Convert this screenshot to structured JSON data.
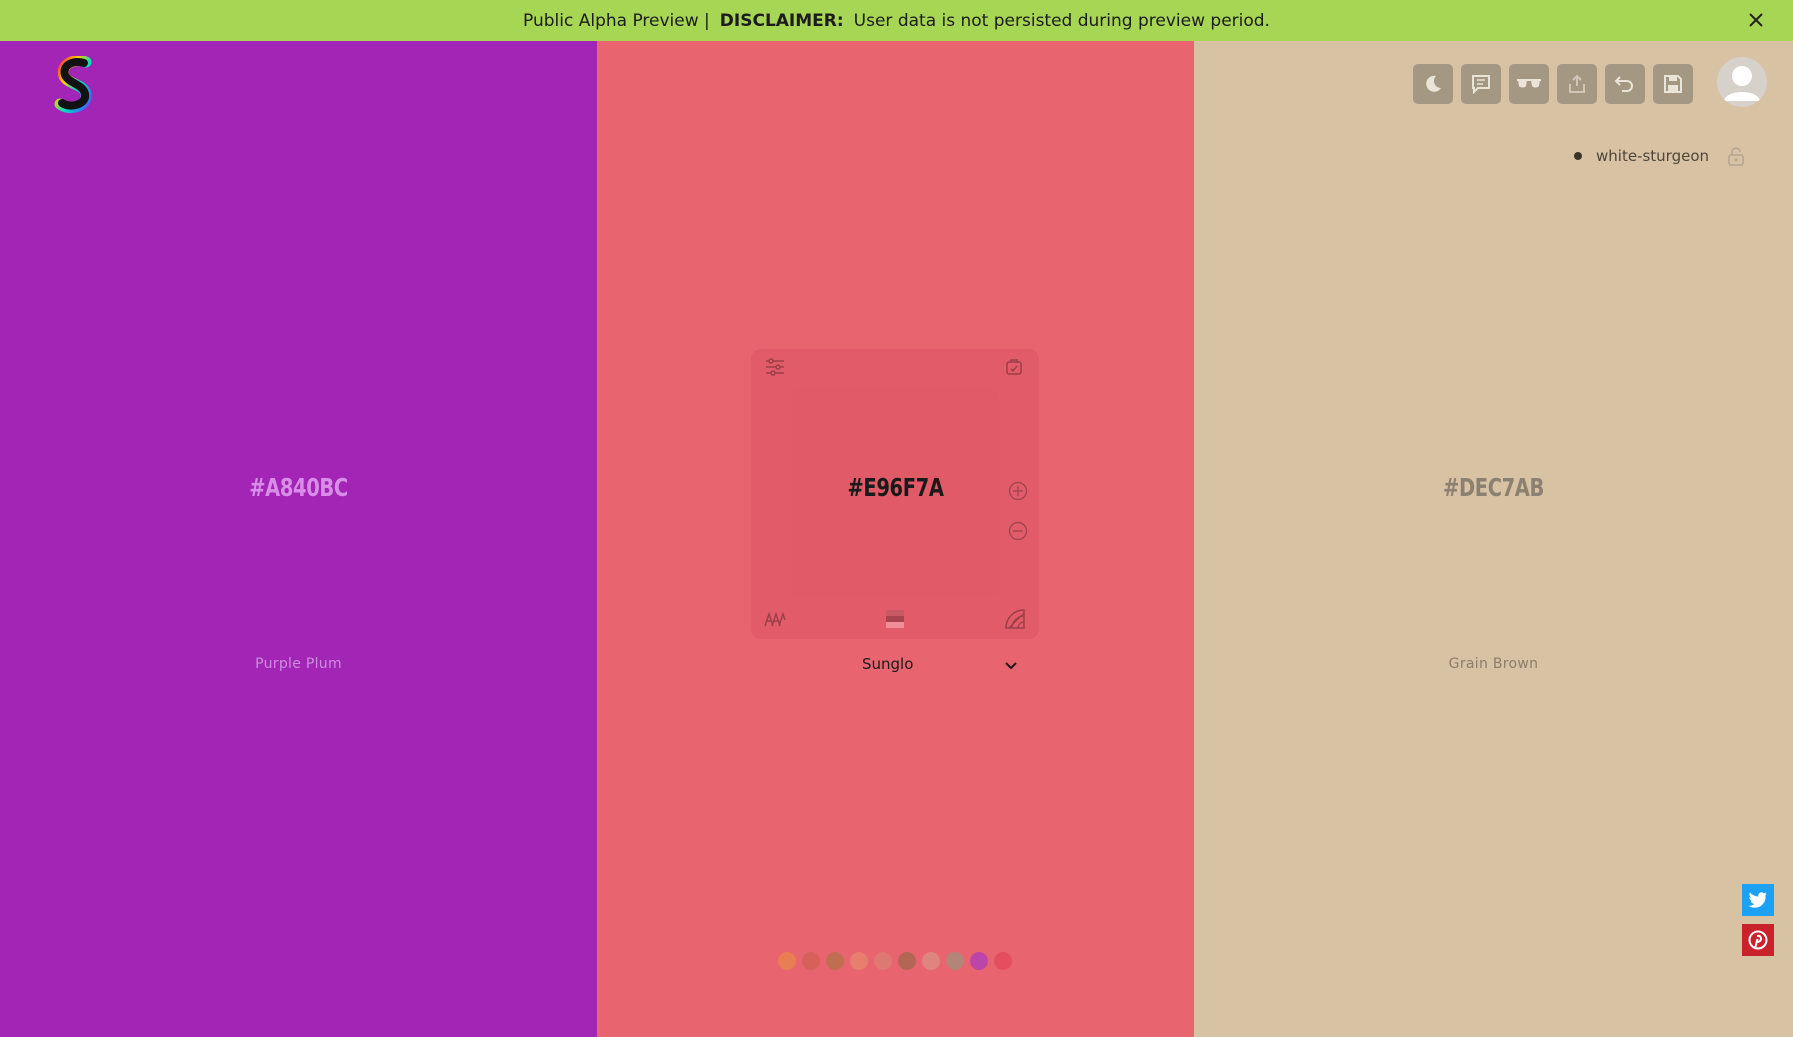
{
  "banner": {
    "prefix": "Public Alpha Preview |",
    "label": "DISCLAIMER:",
    "message": "User data is not persisted during preview period.",
    "close_icon": "close-icon"
  },
  "columns": [
    {
      "hex": "#A840BC",
      "name": "Purple Plum",
      "bg": "#a225b6",
      "text_color": "#d98ce8",
      "name_color": "#d08be0"
    },
    {
      "hex": "#E96F7A",
      "name": "Sunglo",
      "bg": "#e8646e",
      "text_color": "#1a1a1a",
      "name_color": "#1a1a1a"
    },
    {
      "hex": "#DEC7AB",
      "name": "Grain Brown",
      "bg": "#d8c2a4",
      "text_color": "#8c8070",
      "name_color": "#8a7e6d"
    }
  ],
  "toolbar": {
    "buttons": [
      "moon-icon",
      "comment-icon",
      "glasses-icon",
      "share-icon",
      "undo-icon",
      "save-icon"
    ]
  },
  "user": {
    "palette_name": "white-sturgeon",
    "avatar": "avatar-icon",
    "lock_icon": "unlock-icon"
  },
  "panel": {
    "icons": [
      "sliders-icon",
      "tag-icon",
      "plus-icon",
      "minus-icon",
      "contrast-icon",
      "shades-icon",
      "gradient-icon"
    ],
    "selected_name": "Sunglo"
  },
  "history_dots": [
    "#e9824f",
    "#d45f58",
    "#b8704c",
    "#e7826e",
    "#db7b74",
    "#a86751",
    "#dc8b84",
    "#a98b7b",
    "#b43fb3",
    "#e34a5c"
  ],
  "social": {
    "twitter_color": "#1da1f2",
    "pinterest_color": "#c8232c"
  }
}
